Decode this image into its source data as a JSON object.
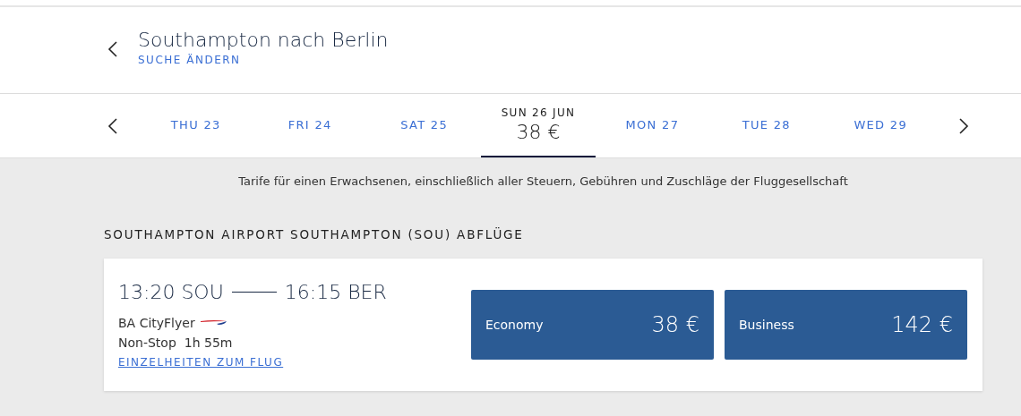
{
  "header": {
    "title": "Southampton nach Berlin",
    "change_link": "SUCHE ÄNDERN"
  },
  "dates": [
    {
      "label": "THU 23",
      "selected": false
    },
    {
      "label": "FRI 24",
      "selected": false
    },
    {
      "label": "SAT 25",
      "selected": false
    },
    {
      "label": "SUN 26 JUN",
      "price": "38 €",
      "selected": true
    },
    {
      "label": "MON 27",
      "selected": false
    },
    {
      "label": "TUE 28",
      "selected": false
    },
    {
      "label": "WED 29",
      "selected": false
    }
  ],
  "fare_note": "Tarife für einen Erwachsenen, einschließlich aller Steuern, Gebühren und Zuschläge der Fluggesellschaft",
  "section_title": "SOUTHAMPTON AIRPORT SOUTHAMPTON (SOU) ABFLÜGE",
  "flights": [
    {
      "departure": "13:20 SOU",
      "arrival": "16:15 BER",
      "airline": "BA CityFlyer",
      "stops": "Non-Stop",
      "duration": "1h 55m",
      "details_link": "EINZELHEITEN ZUM FLUG",
      "fares": [
        {
          "cabin": "Economy",
          "price": "38 €"
        },
        {
          "cabin": "Business",
          "price": "142 €"
        }
      ]
    }
  ]
}
